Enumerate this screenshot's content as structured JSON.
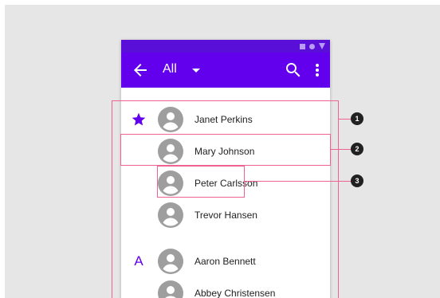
{
  "appbar": {
    "title": "All",
    "back_icon": "arrow-back-icon",
    "dropdown_icon": "caret-down-icon",
    "search_icon": "search-icon",
    "more_icon": "more-vert-icon"
  },
  "status_icons": [
    "square-icon",
    "circle-icon",
    "triangle-icon"
  ],
  "contacts": [
    {
      "name": "Janet Perkins",
      "lead": "star-icon",
      "letter": ""
    },
    {
      "name": "Mary Johnson",
      "lead": "",
      "letter": ""
    },
    {
      "name": "Peter Carlsson",
      "lead": "",
      "letter": ""
    },
    {
      "name": "Trevor Hansen",
      "lead": "",
      "letter": ""
    },
    {
      "name": "Aaron Bennett",
      "lead": "",
      "letter": "A"
    },
    {
      "name": "Abbey Christensen",
      "lead": "",
      "letter": ""
    }
  ],
  "annotations": [
    "1",
    "2",
    "3"
  ],
  "colors": {
    "primary": "#6200ee",
    "status_bar": "#5a0fd8",
    "annotation": "#f06292",
    "avatar": "#9e9e9e"
  }
}
